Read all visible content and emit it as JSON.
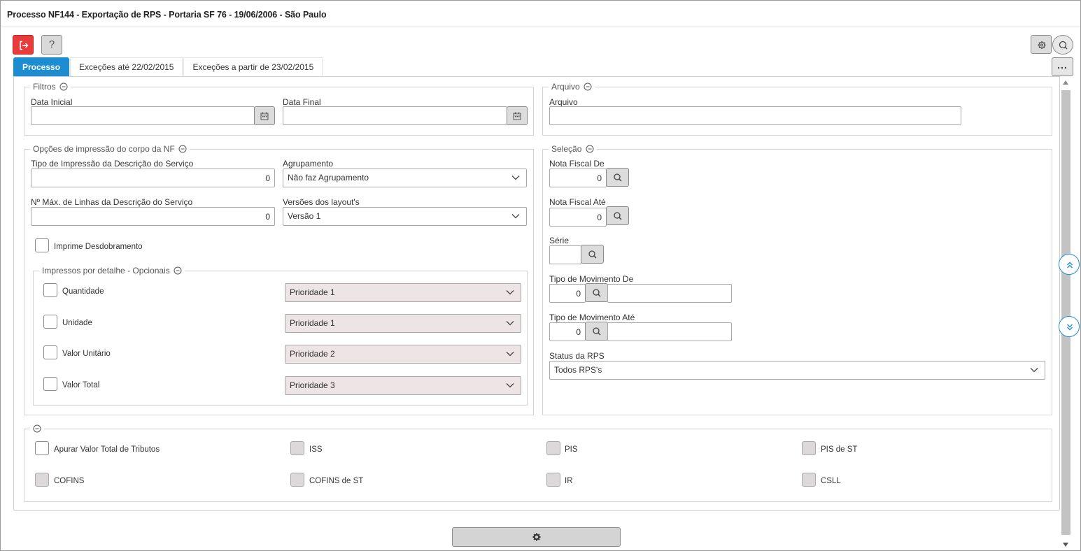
{
  "window": {
    "title": "Processo NF144 - Exportação de RPS - Portaria SF 76 - 19/06/2006 - São Paulo"
  },
  "toolbar": {
    "help_label": "?",
    "more_label": "..."
  },
  "tabs": [
    {
      "label": "Processo",
      "active": true
    },
    {
      "label": "Exceções até 22/02/2015",
      "active": false
    },
    {
      "label": "Exceções a partir de 23/02/2015",
      "active": false
    }
  ],
  "filtros": {
    "legend": "Filtros",
    "data_inicial_label": "Data Inicial",
    "data_inicial_value": "",
    "data_final_label": "Data Final",
    "data_final_value": ""
  },
  "arquivo": {
    "legend": "Arquivo",
    "arquivo_label": "Arquivo",
    "arquivo_value": ""
  },
  "opcoes": {
    "legend": "Opções de impressão do corpo da NF",
    "tipo_impressao_label": "Tipo de Impressão da Descrição do Serviço",
    "tipo_impressao_value": "0",
    "agrupamento_label": "Agrupamento",
    "agrupamento_value": "Não faz Agrupamento",
    "max_linhas_label": "Nº Máx. de Linhas da Descrição do Serviço",
    "max_linhas_value": "0",
    "versoes_label": "Versões dos layout's",
    "versoes_value": "Versão 1",
    "imprime_desdobramento_label": "Imprime Desdobramento"
  },
  "impressos": {
    "legend": "Impressos por detalhe - Opcionais",
    "rows": [
      {
        "label": "Quantidade",
        "priority": "Prioridade 1"
      },
      {
        "label": "Unidade",
        "priority": "Prioridade 1"
      },
      {
        "label": "Valor Unitário",
        "priority": "Prioridade 2"
      },
      {
        "label": "Valor Total",
        "priority": "Prioridade 3"
      }
    ]
  },
  "selecao": {
    "legend": "Seleção",
    "nf_de_label": "Nota Fiscal De",
    "nf_de_value": "0",
    "nf_ate_label": "Nota Fiscal Até",
    "nf_ate_value": "0",
    "serie_label": "Série",
    "serie_value": "",
    "tm_de_label": "Tipo de Movimento De",
    "tm_de_value": "0",
    "tm_de_desc": "",
    "tm_ate_label": "Tipo de Movimento Até",
    "tm_ate_value": "0",
    "tm_ate_desc": "",
    "status_label": "Status da RPS",
    "status_value": "Todos RPS's"
  },
  "tributos": {
    "items": [
      {
        "label": "Apurar Valor Total de Tributos",
        "disabled": false
      },
      {
        "label": "ISS",
        "disabled": true
      },
      {
        "label": "PIS",
        "disabled": true
      },
      {
        "label": "PIS de ST",
        "disabled": true
      },
      {
        "label": "COFINS",
        "disabled": true
      },
      {
        "label": "COFINS de ST",
        "disabled": true
      },
      {
        "label": "IR",
        "disabled": true
      },
      {
        "label": "CSLL",
        "disabled": true
      }
    ]
  },
  "colors": {
    "accent": "#1c8dd0",
    "exit": "#e83b3b",
    "priority_bg": "#ece4e5"
  }
}
